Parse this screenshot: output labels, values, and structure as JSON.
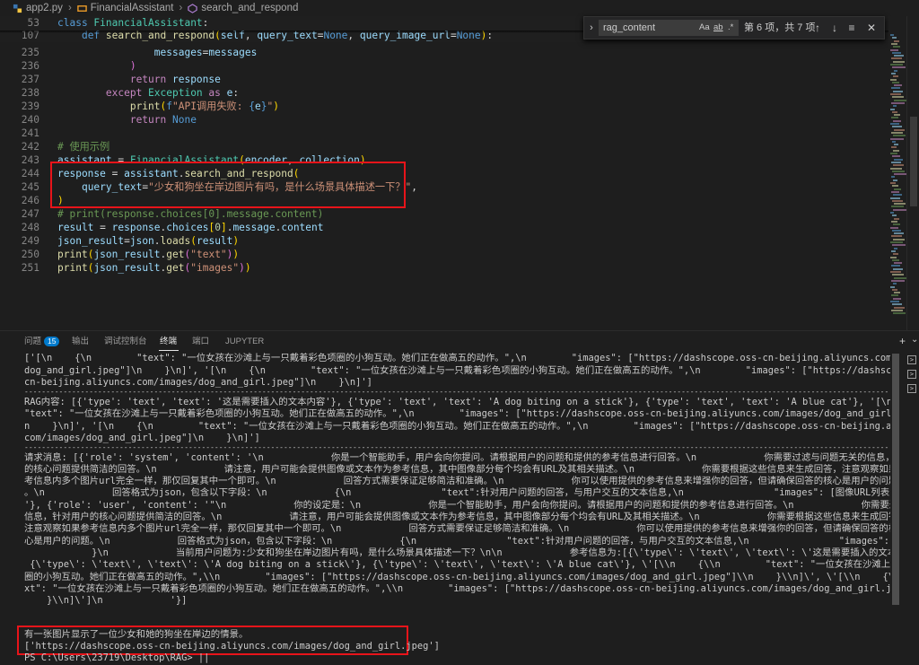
{
  "breadcrumb": {
    "file": "app2.py",
    "class": "FinancialAssistant",
    "method": "search_and_respond"
  },
  "editor": {
    "lines": [
      {
        "n": "53",
        "tokens": [
          [
            "kw",
            "class "
          ],
          [
            "cls",
            "FinancialAssistant"
          ],
          [
            "pl",
            ":"
          ]
        ]
      },
      {
        "n": "107",
        "tokens": [
          [
            "pl",
            "    "
          ],
          [
            "kw",
            "def "
          ],
          [
            "fn",
            "search_and_respond"
          ],
          [
            "brk1",
            "("
          ],
          [
            "var",
            "self"
          ],
          [
            "pl",
            ", "
          ],
          [
            "var",
            "query_text"
          ],
          [
            "pl",
            "="
          ],
          [
            "kw",
            "None"
          ],
          [
            "pl",
            ", "
          ],
          [
            "var",
            "query_image_url"
          ],
          [
            "pl",
            "="
          ],
          [
            "kw",
            "None"
          ],
          [
            "brk1",
            ")"
          ],
          [
            "pl",
            ":"
          ]
        ]
      },
      {
        "n": "235",
        "tokens": [
          [
            "pl",
            "                "
          ],
          [
            "var",
            "messages"
          ],
          [
            "pl",
            "="
          ],
          [
            "var",
            "messages"
          ]
        ]
      },
      {
        "n": "236",
        "tokens": [
          [
            "pl",
            "            "
          ],
          [
            "brk2",
            ")"
          ]
        ]
      },
      {
        "n": "237",
        "tokens": [
          [
            "pl",
            "            "
          ],
          [
            "kw2",
            "return "
          ],
          [
            "var",
            "response"
          ]
        ]
      },
      {
        "n": "238",
        "tokens": [
          [
            "pl",
            "        "
          ],
          [
            "kw2",
            "except "
          ],
          [
            "cls",
            "Exception "
          ],
          [
            "kw2",
            "as "
          ],
          [
            "var",
            "e"
          ],
          [
            "pl",
            ":"
          ]
        ]
      },
      {
        "n": "239",
        "tokens": [
          [
            "pl",
            "            "
          ],
          [
            "fn",
            "print"
          ],
          [
            "brk1",
            "("
          ],
          [
            "kw",
            "f"
          ],
          [
            "str",
            "\"API调用失败: "
          ],
          [
            "kw",
            "{"
          ],
          [
            "var",
            "e"
          ],
          [
            "kw",
            "}"
          ],
          [
            "str",
            "\""
          ],
          [
            "brk1",
            ")"
          ]
        ]
      },
      {
        "n": "240",
        "tokens": [
          [
            "pl",
            "            "
          ],
          [
            "kw2",
            "return "
          ],
          [
            "kw",
            "None"
          ]
        ]
      },
      {
        "n": "241",
        "tokens": []
      },
      {
        "n": "242",
        "tokens": [
          [
            "cmt",
            "# 使用示例"
          ]
        ]
      },
      {
        "n": "243",
        "tokens": [
          [
            "var",
            "assistant"
          ],
          [
            "pl",
            " = "
          ],
          [
            "cls",
            "FinancialAssistant"
          ],
          [
            "brk1",
            "("
          ],
          [
            "var",
            "encoder"
          ],
          [
            "pl",
            ", "
          ],
          [
            "var",
            "collection"
          ],
          [
            "brk1",
            ")"
          ]
        ]
      },
      {
        "n": "244",
        "tokens": [
          [
            "var",
            "response"
          ],
          [
            "pl",
            " = "
          ],
          [
            "var",
            "assistant"
          ],
          [
            "pl",
            "."
          ],
          [
            "fn",
            "search_and_respond"
          ],
          [
            "brk1",
            "("
          ]
        ]
      },
      {
        "n": "245",
        "tokens": [
          [
            "pl",
            "    "
          ],
          [
            "var",
            "query_text"
          ],
          [
            "pl",
            "="
          ],
          [
            "str",
            "\"少女和狗坐在岸边图片有吗，是什么场景具体描述一下？\""
          ],
          [
            "pl",
            ","
          ]
        ]
      },
      {
        "n": "246",
        "tokens": [
          [
            "brk1",
            ")"
          ]
        ]
      },
      {
        "n": "247",
        "tokens": [
          [
            "cmt",
            "# print(response.choices[0].message.content)"
          ]
        ]
      },
      {
        "n": "248",
        "tokens": [
          [
            "var",
            "result"
          ],
          [
            "pl",
            " = "
          ],
          [
            "var",
            "response"
          ],
          [
            "pl",
            "."
          ],
          [
            "var",
            "choices"
          ],
          [
            "brk1",
            "["
          ],
          [
            "num",
            "0"
          ],
          [
            "brk1",
            "]"
          ],
          [
            "pl",
            "."
          ],
          [
            "var",
            "message"
          ],
          [
            "pl",
            "."
          ],
          [
            "var",
            "content"
          ]
        ]
      },
      {
        "n": "249",
        "tokens": [
          [
            "var",
            "json_result"
          ],
          [
            "pl",
            "="
          ],
          [
            "var",
            "json"
          ],
          [
            "pl",
            "."
          ],
          [
            "fn",
            "loads"
          ],
          [
            "brk1",
            "("
          ],
          [
            "var",
            "result"
          ],
          [
            "brk1",
            ")"
          ]
        ]
      },
      {
        "n": "250",
        "tokens": [
          [
            "fn",
            "print"
          ],
          [
            "brk1",
            "("
          ],
          [
            "var",
            "json_result"
          ],
          [
            "pl",
            "."
          ],
          [
            "fn",
            "get"
          ],
          [
            "brk2",
            "("
          ],
          [
            "str",
            "\"text\""
          ],
          [
            "brk2",
            ")"
          ],
          [
            "brk1",
            ")"
          ]
        ]
      },
      {
        "n": "251",
        "tokens": [
          [
            "fn",
            "print"
          ],
          [
            "brk1",
            "("
          ],
          [
            "var",
            "json_result"
          ],
          [
            "pl",
            "."
          ],
          [
            "fn",
            "get"
          ],
          [
            "brk2",
            "("
          ],
          [
            "str",
            "\"images\""
          ],
          [
            "brk2",
            ")"
          ],
          [
            "brk1",
            ")"
          ]
        ]
      }
    ]
  },
  "find": {
    "value": "rag_content",
    "count": "第 6 项，共 7 项",
    "opt_case": "Aa",
    "opt_word": "ab",
    "opt_regex": ".*"
  },
  "panel": {
    "tabs": [
      {
        "label": "问题",
        "badge": "15"
      },
      {
        "label": "输出"
      },
      {
        "label": "调试控制台"
      },
      {
        "label": "终端"
      },
      {
        "label": "端口"
      },
      {
        "label": "JUPYTER"
      }
    ],
    "terminal": {
      "lines": [
        "['[\\n    {\\n        \"text\": \"一位女孩在沙滩上与一只戴着彩色项圈的小狗互动。她们正在做高五的动作。\",\\n        \"images\": [\"https://dashscope.oss-cn-beijing.aliyuncs.com/images/",
        "dog_and_girl.jpeg\"]\\n    }\\n]', '[\\n    {\\n        \"text\": \"一位女孩在沙滩上与一只戴着彩色项圈的小狗互动。她们正在做高五的动作。\",\\n        \"images\": [\"https://dashscope.oss-",
        "cn-beijing.aliyuncs.com/images/dog_and_girl.jpeg\"]\\n    }\\n]']",
        "RAG内容: [{'type': 'text', 'text': '这是需要插入的文本内容'}, {'type': 'text', 'text': 'A dog biting on a stick'}, {'type': 'text', 'text': 'A blue cat'}, '[\\n    {\\n",
        "\"text\": \"一位女孩在沙滩上与一只戴着彩色项圈的小狗互动。她们正在做高五的动作。\",\\n        \"images\": [\"https://dashscope.oss-cn-beijing.aliyuncs.com/images/dog_and_girl.jpeg\"]\\",
        "n    }\\n]', '[\\n    {\\n        \"text\": \"一位女孩在沙滩上与一只戴着彩色项圈的小狗互动。她们正在做高五的动作。\",\\n        \"images\": [\"https://dashscope.oss-cn-beijing.aliyuncs.",
        "com/images/dog_and_girl.jpeg\"]\\n    }\\n]']",
        "请求消息: [{'role': 'system', 'content': '\\n            你是一个智能助手，用户会向你提问。请根据用户的问题和提供的参考信息进行回答。\\n            你需要过滤与问题无关的信息，针对用户",
        "的核心问题提供简洁的回答。\\n            请注意，用户可能会提供图像或文本作为参考信息，其中图像部分每个均会有URL及其相关描述。\\n            你需要根据这些信息来生成回答，注意观察如果参",
        "考信息内多个图片url完全一样，那仅回复其中一个即可。\\n            回答方式需要保证足够简洁和准确。\\n            你可以使用提供的参考信息来增强你的回答，但请确保回答的核心是用户的问题",
        "。\\n            回答格式为json，包含以下字段：\\n            {\\n                \"text\":针对用户问题的回答，与用户交互的文本信息,\\n                \"images\": [图像URL列表],\\n            }\\n",
        "'}, {'role': 'user', 'content': '\"\\n            你的设定是：\\n            你是一个智能助手，用户会向你提问。请根据用户的问题和提供的参考信息进行回答。\\n            你需要过滤与问题无关的",
        "信息，针对用户的核心问题提供简洁的回答。\\n            请注意，用户可能会提供图像或文本作为参考信息，其中图像部分每个均会有URL及其相关描述。\\n            你需要根据这些信息来生成回答，",
        "注意观察如果参考信息内多个图片url完全一样，那仅回复其中一个即可。\\n            回答方式需要保证足够简洁和准确。\\n            你可以使用提供的参考信息来增强你的回答，但请确保回答的核",
        "心是用户的问题。\\n            回答格式为json，包含以下字段：\\n            {\\n                \"text\":针对用户问题的回答，与用户交互的文本信息,\\n                \"images\": [图像URL列表],\\n",
        "            }\\n            当前用户问题为:少女和狗坐在岸边图片有吗，是什么场景具体描述一下？\\n\\n            参考信息为:[{\\'type\\': \\'text\\', \\'text\\': \\'这是需要插入的文本内容\\'},",
        " {\\'type\\': \\'text\\', \\'text\\': \\'A dog biting on a stick\\'}, {\\'type\\': \\'text\\', \\'text\\': \\'A blue cat\\'}, \\'[\\\\n    {\\\\n        \"text\": \"一位女孩在沙滩上与一只戴着彩色项",
        "圈的小狗互动。她们正在做高五的动作。\",\\\\n        \"images\": [\"https://dashscope.oss-cn-beijing.aliyuncs.com/images/dog_and_girl.jpeg\"]\\\\n    }\\\\n]\\', \\'[\\\\n    {\\\\n        \"te",
        "xt\": \"一位女孩在沙滩上与一只戴着彩色项圈的小狗互动。她们正在做高五的动作。\",\\\\n        \"images\": [\"https://dashscope.oss-cn-beijing.aliyuncs.com/images/dog_and_girl.jpeg\"]\\\\n",
        "    }\\\\n]\\']\\n            '}]"
      ],
      "separator": "------------------------------------------------------------------------------------------------------------------------------------------------------------------------------------------------------------------------",
      "output_text": "有一张图片显示了一位少女和她的狗坐在岸边的情景。",
      "output_images": "['https://dashscope.oss-cn-beijing.aliyuncs.com/images/dog_and_girl.jpeg']",
      "prompt": "PS C:\\Users\\23719\\Desktop\\RAG> ||"
    }
  },
  "colors": {
    "highlight_box": "#e8141a",
    "accent": "#007acc"
  }
}
